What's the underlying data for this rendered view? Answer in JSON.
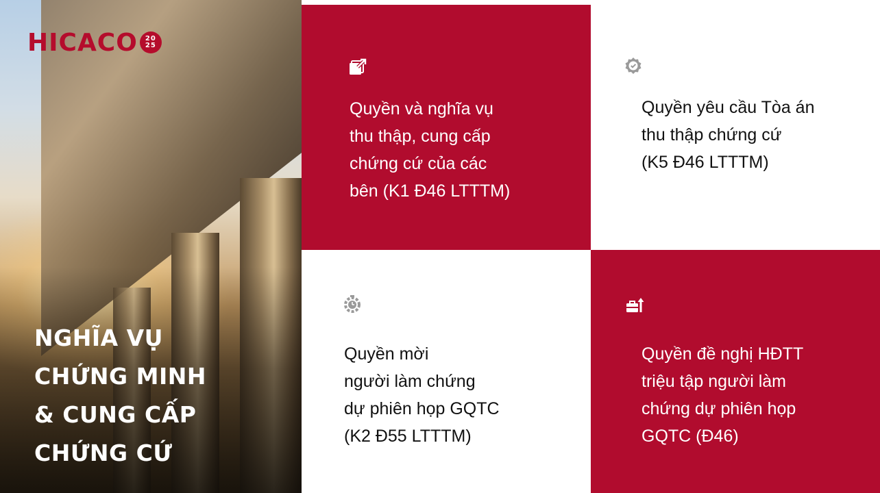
{
  "brand": {
    "logo_text": "HICACO",
    "logo_badge_top": "20",
    "logo_badge_bottom": "25",
    "accent_color": "#b10c2e"
  },
  "hero": {
    "title_lines": [
      "NGHĨA VỤ",
      "CHỨNG MINH",
      "& CUNG CẤP",
      "CHỨNG CỨ"
    ]
  },
  "tiles": [
    {
      "icon": "external-link-icon",
      "style": "red",
      "lines": [
        "Quyền và nghĩa vụ",
        "thu thập, cung cấp",
        "chứng cứ của các",
        "bên (K1 Đ46 LTTTM)"
      ]
    },
    {
      "icon": "badge-check-icon",
      "style": "white",
      "lines": [
        "Quyền yêu cầu Tòa án",
        "thu thập chứng cứ",
        "(K5 Đ46 LTTTM)"
      ]
    },
    {
      "icon": "gear-timer-icon",
      "style": "white",
      "lines": [
        "Quyền mời",
        "người làm chứng",
        "dự phiên họp GQTC",
        "(K2 Đ55 LTTTM)"
      ]
    },
    {
      "icon": "briefcase-up-icon",
      "style": "red",
      "lines": [
        "Quyền đề nghị HĐTT",
        "triệu tập người làm",
        "chứng dự phiên họp",
        "GQTC (Đ46)"
      ]
    }
  ]
}
